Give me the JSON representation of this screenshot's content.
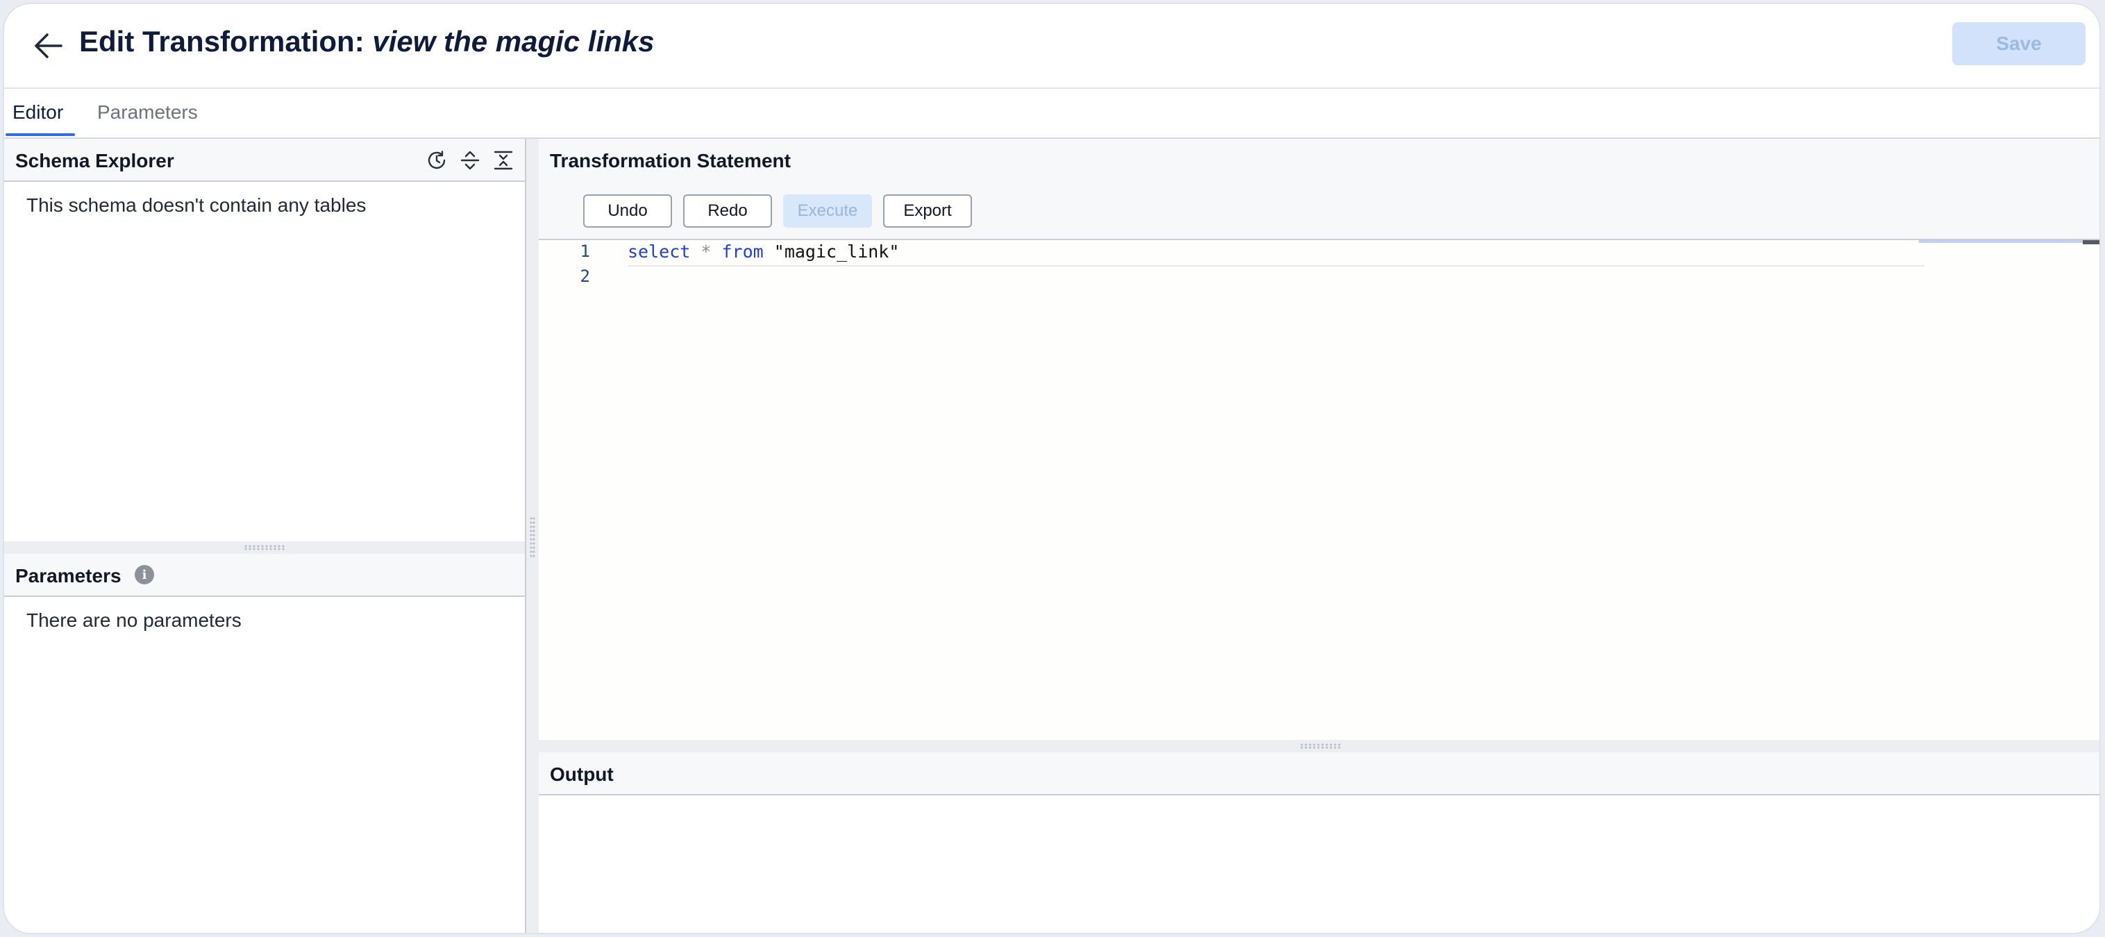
{
  "header": {
    "title_prefix": "Edit Transformation: ",
    "title_name": "view the magic links",
    "save_label": "Save"
  },
  "tabs": [
    {
      "label": "Editor",
      "active": true
    },
    {
      "label": "Parameters",
      "active": false
    }
  ],
  "schema_explorer": {
    "title": "Schema Explorer",
    "empty_message": "This schema doesn't contain any tables",
    "icons": [
      "refresh-clock-icon",
      "expand-all-icon",
      "collapse-all-icon"
    ]
  },
  "parameters_panel": {
    "title": "Parameters",
    "empty_message": "There are no parameters",
    "info_icon": "info-icon"
  },
  "statement": {
    "title": "Transformation Statement",
    "toolbar": {
      "undo": "Undo",
      "redo": "Redo",
      "execute": "Execute",
      "export": "Export"
    },
    "line_numbers": [
      "1",
      "2"
    ],
    "code": {
      "keyword1": "select",
      "operator": "*",
      "keyword2": "from",
      "string": "\"magic_link\""
    }
  },
  "output": {
    "title": "Output"
  },
  "colors": {
    "accent": "#2f6de0",
    "save_disabled_bg": "#d2e2fb",
    "keyword": "#1f3fd3"
  }
}
